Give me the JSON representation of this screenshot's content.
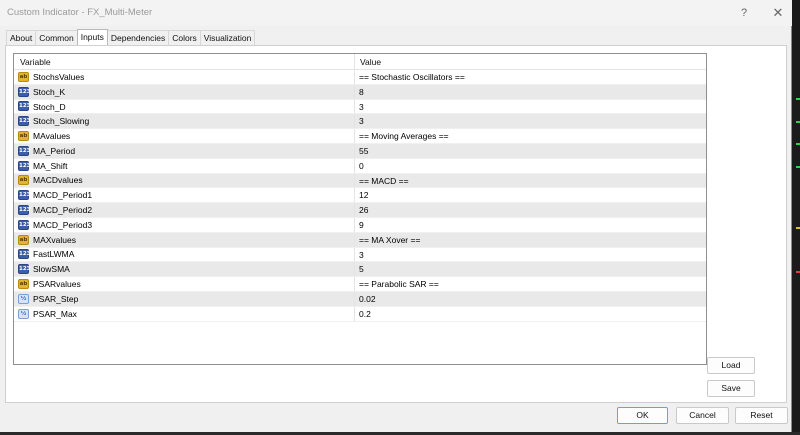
{
  "window": {
    "title": "Custom Indicator - FX_Multi-Meter",
    "help_label": "?",
    "close_label": "✕"
  },
  "tabs": [
    "About",
    "Common",
    "Inputs",
    "Dependencies",
    "Colors",
    "Visualization"
  ],
  "active_tab": "Inputs",
  "table": {
    "headers": {
      "variable": "Variable",
      "value": "Value"
    },
    "rows": [
      {
        "icon": "string-icon",
        "icon_text": "ab",
        "name": "StochsValues",
        "value": "== Stochastic Oscillators =="
      },
      {
        "icon": "integer-icon",
        "icon_text": "123",
        "name": "Stoch_K",
        "value": "8"
      },
      {
        "icon": "integer-icon",
        "icon_text": "123",
        "name": "Stoch_D",
        "value": "3"
      },
      {
        "icon": "integer-icon",
        "icon_text": "123",
        "name": "Stoch_Slowing",
        "value": "3"
      },
      {
        "icon": "string-icon",
        "icon_text": "ab",
        "name": "MAvalues",
        "value": "== Moving Averages =="
      },
      {
        "icon": "integer-icon",
        "icon_text": "123",
        "name": "MA_Period",
        "value": "55"
      },
      {
        "icon": "integer-icon",
        "icon_text": "123",
        "name": "MA_Shift",
        "value": "0"
      },
      {
        "icon": "string-icon",
        "icon_text": "ab",
        "name": "MACDvalues",
        "value": "== MACD =="
      },
      {
        "icon": "integer-icon",
        "icon_text": "123",
        "name": "MACD_Period1",
        "value": "12"
      },
      {
        "icon": "integer-icon",
        "icon_text": "123",
        "name": "MACD_Period2",
        "value": "26"
      },
      {
        "icon": "integer-icon",
        "icon_text": "123",
        "name": "MACD_Period3",
        "value": "9"
      },
      {
        "icon": "string-icon",
        "icon_text": "ab",
        "name": "MAXvalues",
        "value": "== MA Xover =="
      },
      {
        "icon": "integer-icon",
        "icon_text": "123",
        "name": "FastLWMA",
        "value": "3"
      },
      {
        "icon": "integer-icon",
        "icon_text": "123",
        "name": "SlowSMA",
        "value": "5"
      },
      {
        "icon": "string-icon",
        "icon_text": "ab",
        "name": "PSARvalues",
        "value": "== Parabolic SAR =="
      },
      {
        "icon": "double-icon",
        "icon_text": "½",
        "name": "PSAR_Step",
        "value": "0.02"
      },
      {
        "icon": "double-icon",
        "icon_text": "½",
        "name": "PSAR_Max",
        "value": "0.2"
      }
    ]
  },
  "side_buttons": {
    "load": "Load",
    "save": "Save"
  },
  "footer_buttons": {
    "ok": "OK",
    "cancel": "Cancel",
    "reset": "Reset"
  },
  "colors": {
    "accent_blue": "#6e9fd8",
    "string_icon": "#e3b52b",
    "integer_icon": "#3d5fa8"
  }
}
